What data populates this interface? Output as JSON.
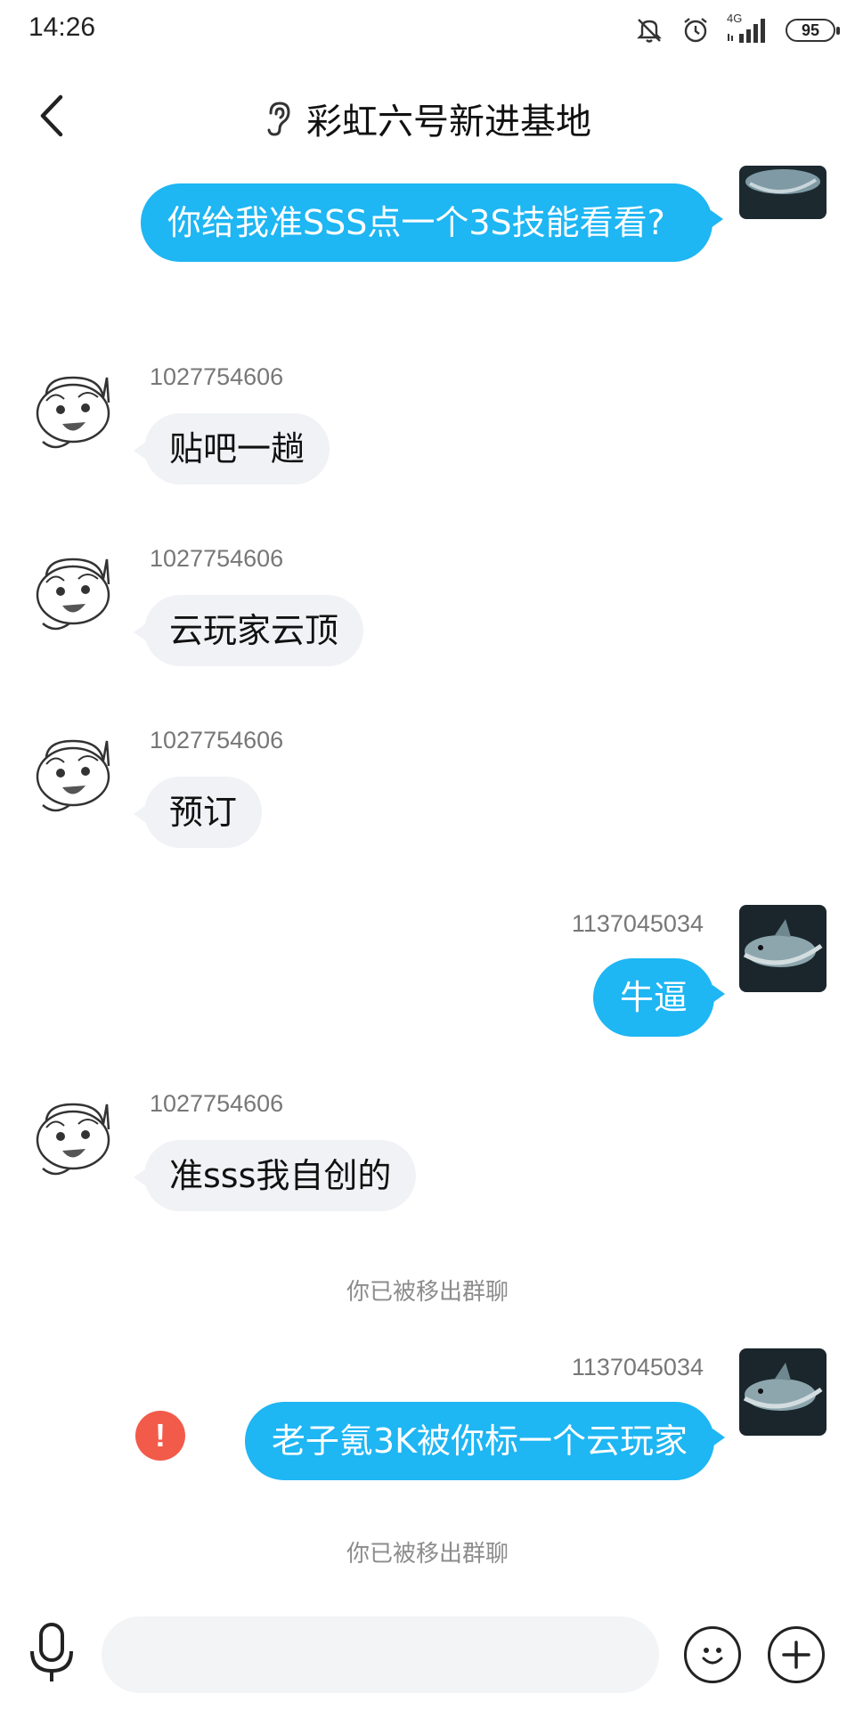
{
  "status_bar": {
    "time": "14:26",
    "network": "4G",
    "battery": "95",
    "icons": [
      "mute-icon",
      "alarm-icon",
      "signal-icon",
      "battery-icon"
    ]
  },
  "header": {
    "back_icon": "chevron-left-icon",
    "earpiece_icon": "ear-icon",
    "title": "彩虹六号新进基地"
  },
  "messages": [
    {
      "direction": "out",
      "sender": "",
      "text": "你给我准SSS点一个3S技能看看?"
    },
    {
      "direction": "in",
      "sender": "1027754606",
      "text": "贴吧一趟"
    },
    {
      "direction": "in",
      "sender": "1027754606",
      "text": "云玩家云顶"
    },
    {
      "direction": "in",
      "sender": "1027754606",
      "text": "预订"
    },
    {
      "direction": "out",
      "sender": "1137045034",
      "text": "牛逼"
    },
    {
      "direction": "in",
      "sender": "1027754606",
      "text": "准sss我自创的"
    },
    {
      "direction": "system",
      "text": "你已被移出群聊"
    },
    {
      "direction": "out",
      "sender": "1137045034",
      "text": "老子氪3K被你标一个云玩家",
      "status": "failed",
      "status_icon": "!"
    },
    {
      "direction": "system",
      "text": "你已被移出群聊"
    }
  ],
  "input_bar": {
    "voice_icon": "microphone-icon",
    "emoji_icon": "smiley-icon",
    "more_icon": "plus-icon",
    "placeholder": ""
  },
  "colors": {
    "outgoing_bubble": "#1eb6f3",
    "incoming_bubble": "#f1f2f5",
    "error": "#f25b4a"
  }
}
